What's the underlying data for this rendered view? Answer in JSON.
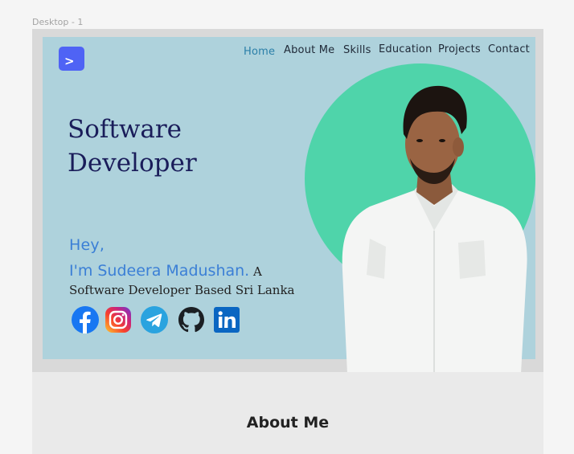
{
  "frame": {
    "label": "Desktop - 1"
  },
  "logo": {
    "glyph": ">"
  },
  "nav": {
    "items": [
      {
        "label": "Home",
        "active": true
      },
      {
        "label": "About Me",
        "active": false
      },
      {
        "label": "Skills",
        "active": false
      },
      {
        "label": "Education",
        "active": false
      },
      {
        "label": "Projects",
        "active": false
      },
      {
        "label": "Contact",
        "active": false
      }
    ]
  },
  "hero": {
    "title_line1": "Software",
    "title_line2": "Developer",
    "greeting": "Hey,",
    "name": "I'm Sudeera Madushan.",
    "tagline": " A Software Developer Based Sri Lanka"
  },
  "socials": [
    {
      "icon": "facebook-icon"
    },
    {
      "icon": "instagram-icon"
    },
    {
      "icon": "telegram-icon"
    },
    {
      "icon": "github-icon"
    },
    {
      "icon": "linkedin-icon"
    }
  ],
  "about": {
    "heading": "About Me"
  },
  "colors": {
    "hero_bg": "#aed2dc",
    "accent_circle": "#4fd4aa",
    "logo_bg": "#4f63f5",
    "title": "#1a1d5a",
    "name": "#3b7fd6",
    "nav_active": "#2a7fa8"
  }
}
